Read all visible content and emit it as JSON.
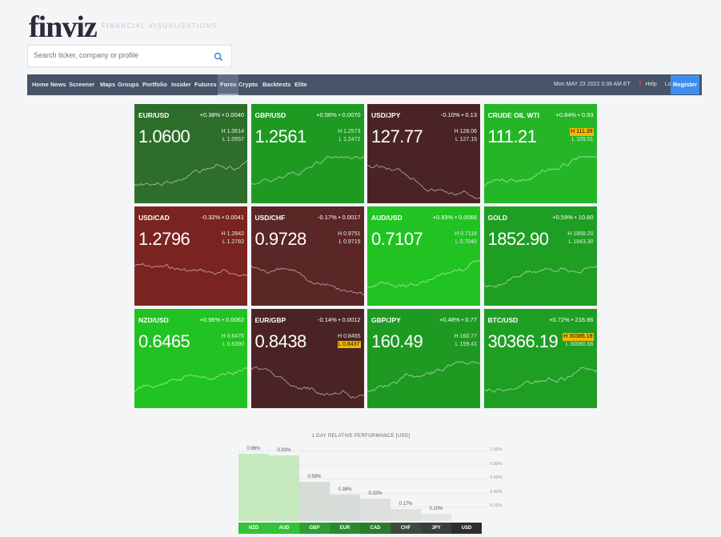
{
  "header": {
    "logo": "finviz",
    "tagline": "FINANCIAL VISUALIZATIONS",
    "search_placeholder": "Search ticker, company or profile"
  },
  "nav": {
    "items": [
      {
        "label": "Home",
        "active": false
      },
      {
        "label": "News",
        "active": false
      },
      {
        "label": "Screener",
        "active": false
      },
      {
        "label": "Maps",
        "active": false
      },
      {
        "label": "Groups",
        "active": false
      },
      {
        "label": "Portfolio",
        "active": false
      },
      {
        "label": "Insider",
        "active": false
      },
      {
        "label": "Futures",
        "active": false
      },
      {
        "label": "Forex",
        "active": true
      },
      {
        "label": "Crypto",
        "active": false
      },
      {
        "label": "Backtests",
        "active": false
      },
      {
        "label": "Elite",
        "active": false
      }
    ],
    "datetime": "Mon MAY 23 2022 3:39 AM ET",
    "help": "Help",
    "login": "Login",
    "register": "Register"
  },
  "tiles": [
    {
      "name": "EUR/USD",
      "change": "+0.38% • 0.0040",
      "price": "1.0600",
      "high": "H 1.0614",
      "low": "L 1.0557",
      "color": "#2d6e2a",
      "trend": "up",
      "mark": ""
    },
    {
      "name": "GBP/USD",
      "change": "+0.56% • 0.0070",
      "price": "1.2561",
      "high": "H 1.2573",
      "low": "L 1.2472",
      "color": "#1e9a22",
      "trend": "up",
      "mark": ""
    },
    {
      "name": "USD/JPY",
      "change": "-0.10% • 0.13",
      "price": "127.77",
      "high": "H 128.06",
      "low": "L 127.15",
      "color": "#4a2425",
      "trend": "down",
      "mark": ""
    },
    {
      "name": "CRUDE OIL WTI",
      "change": "+0.84% • 0.93",
      "price": "111.21",
      "high": "H 111.39",
      "low": "L 109.51",
      "color": "#25b628",
      "trend": "up",
      "mark": "high"
    },
    {
      "name": "USD/CAD",
      "change": "-0.32% • 0.0041",
      "price": "1.2796",
      "high": "H 1.2842",
      "low": "L 1.2782",
      "color": "#7a2421",
      "trend": "down",
      "mark": ""
    },
    {
      "name": "USD/CHF",
      "change": "-0.17% • 0.0017",
      "price": "0.9728",
      "high": "H 0.9751",
      "low": "L 0.9715",
      "color": "#5a2626",
      "trend": "down",
      "mark": ""
    },
    {
      "name": "AUD/USD",
      "change": "+0.93% • 0.0066",
      "price": "0.7107",
      "high": "H 0.7116",
      "low": "L 0.7040",
      "color": "#21c322",
      "trend": "up",
      "mark": ""
    },
    {
      "name": "GOLD",
      "change": "+0.59% • 10.80",
      "price": "1852.90",
      "high": "H 1858.20",
      "low": "L 1843.30",
      "color": "#1f9e24",
      "trend": "up",
      "mark": ""
    },
    {
      "name": "NZD/USD",
      "change": "+0.96% • 0.0062",
      "price": "0.6465",
      "high": "H 0.6476",
      "low": "L 0.6390",
      "color": "#21c322",
      "trend": "up",
      "mark": ""
    },
    {
      "name": "EUR/GBP",
      "change": "-0.14% • 0.0012",
      "price": "0.8438",
      "high": "H 0.8465",
      "low": "L 0.8437",
      "color": "#4a2425",
      "trend": "down",
      "mark": "low"
    },
    {
      "name": "GBP/JPY",
      "change": "+0.48% • 0.77",
      "price": "160.49",
      "high": "H 160.77",
      "low": "L 159.41",
      "color": "#1e9a22",
      "trend": "up",
      "mark": ""
    },
    {
      "name": "BTC/USD",
      "change": "+0.72% • 216.86",
      "price": "30366.19",
      "high": "H 30386.19",
      "low": "L 30090.66",
      "color": "#1f9e24",
      "trend": "up",
      "mark": "high"
    }
  ],
  "performance": {
    "title": "1 DAY RELATIVE PERFORMANCE [USD]",
    "tick_labels": [
      "1.00%",
      "0.80%",
      "0.60%",
      "0.40%",
      "0.20%"
    ]
  },
  "chart_data": {
    "type": "bar",
    "title": "1 DAY RELATIVE PERFORMANCE [USD]",
    "categories": [
      "NZD",
      "AUD",
      "GBP",
      "EUR",
      "CAD",
      "CHF",
      "JPY",
      "USD"
    ],
    "values": [
      0.96,
      0.93,
      0.56,
      0.38,
      0.32,
      0.17,
      0.1,
      0.0
    ],
    "value_labels": [
      "0.96%",
      "0.93%",
      "0.56%",
      "0.38%",
      "0.32%",
      "0.17%",
      "0.10%",
      ""
    ],
    "ylim": [
      0,
      1.0
    ],
    "grid": true
  }
}
